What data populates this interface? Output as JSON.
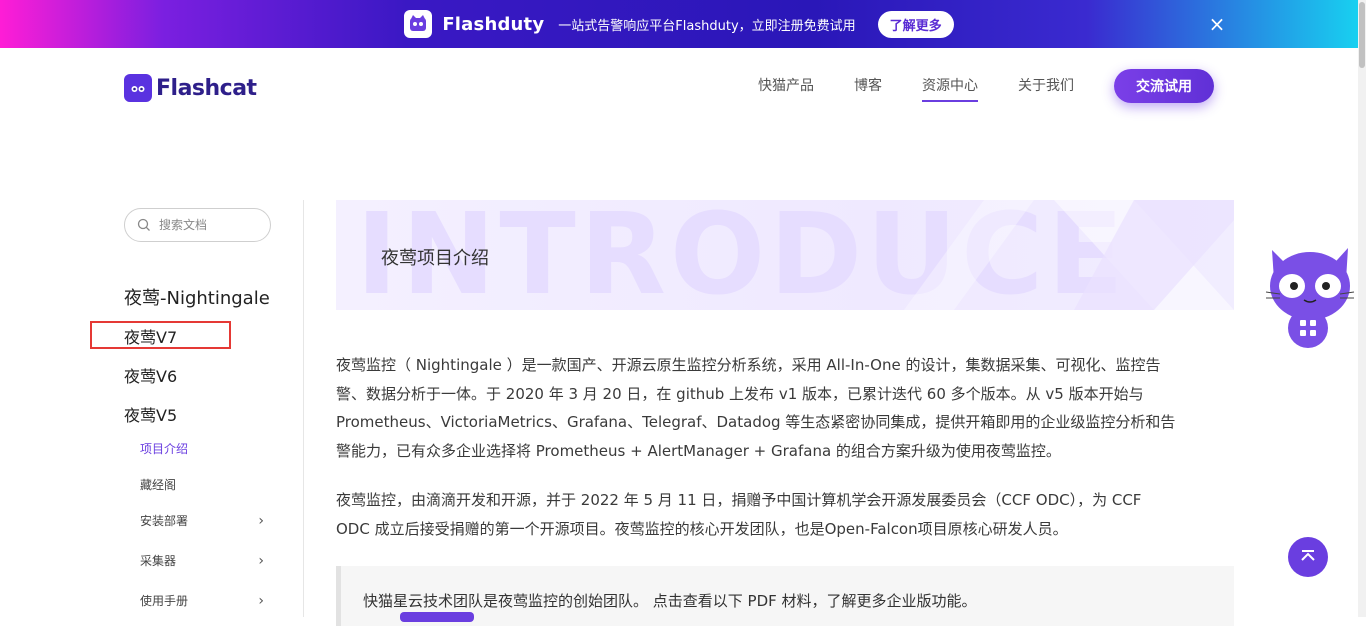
{
  "banner": {
    "brand": "Flashduty",
    "text": "一站式告警响应平台Flashduty，立即注册免费试用",
    "button": "了解更多",
    "close": "×"
  },
  "header": {
    "logo": "Flashcat",
    "nav": [
      "快猫产品",
      "博客",
      "资源中心",
      "关于我们"
    ],
    "active_nav": "资源中心",
    "cta": "交流试用"
  },
  "sidebar": {
    "search_placeholder": "搜索文档",
    "title": "夜莺-Nightingale",
    "versions": [
      "夜莺V7",
      "夜莺V6",
      "夜莺V5"
    ],
    "sub_items": [
      {
        "label": "项目介绍",
        "active": true,
        "expandable": false
      },
      {
        "label": "藏经阁",
        "active": false,
        "expandable": false
      },
      {
        "label": "安装部署",
        "active": false,
        "expandable": true
      },
      {
        "label": "采集器",
        "active": false,
        "expandable": true
      },
      {
        "label": "使用手册",
        "active": false,
        "expandable": true
      }
    ]
  },
  "main": {
    "hero_bg": "INTRODUCE",
    "hero_title": "夜莺项目介绍",
    "para1_lines": [
      "夜莺监控（ Nightingale ）是一款国产、开源云原生监控分析系统，采用 All-In-One 的设计，集数据采集、可视化、监控告",
      "警、数据分析于一体。于 2020 年 3 月 20 日，在 github 上发布 v1 版本，已累计迭代 60 多个版本。从 v5 版本开始与",
      "Prometheus、VictoriaMetrics、Grafana、Telegraf、Datadog 等生态紧密协同集成，提供开箱即用的企业级监控分析和告",
      "警能力，已有众多企业选择将 Prometheus + AlertManager + Grafana 的组合方案升级为使用夜莺监控。"
    ],
    "para2_lines": [
      "夜莺监控，由滴滴开发和开源，并于 2022 年 5 月 11 日，捐赠予中国计算机学会开源发展委员会（CCF ODC），为 CCF",
      "ODC 成立后接受捐赠的第一个开源项目。夜莺监控的核心开发团队，也是Open-Falcon项目原核心研发人员。"
    ],
    "quote": "快猫星云技术团队是夜莺监控的创始团队。 点击查看以下 PDF 材料，了解更多企业版功能。"
  },
  "colors": {
    "accent": "#6a3ee0",
    "highlight_border": "#e53935"
  },
  "icons": {
    "mascot": "cat-mascot-icon",
    "grid": "grid-icon",
    "top": "chevron-up-icon"
  }
}
